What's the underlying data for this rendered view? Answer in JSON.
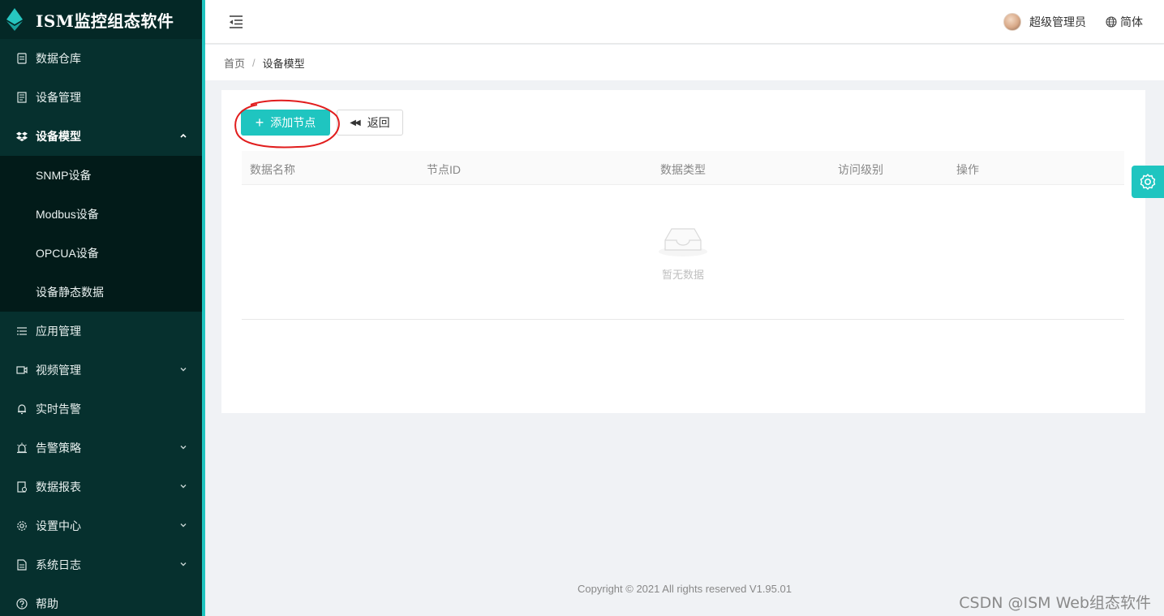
{
  "brand": {
    "title": "ISM监控组态软件",
    "accent_color": "#1fc5c0",
    "sidebar_bg": "#06302e"
  },
  "sidebar": {
    "items": [
      {
        "label": "数据仓库",
        "icon": "database-icon"
      },
      {
        "label": "设备管理",
        "icon": "device-icon"
      },
      {
        "label": "设备模型",
        "icon": "dropbox-icon",
        "expanded": true
      },
      {
        "label": "应用管理",
        "icon": "list-icon"
      },
      {
        "label": "视频管理",
        "icon": "video-icon"
      },
      {
        "label": "实时告警",
        "icon": "bell-icon"
      },
      {
        "label": "告警策略",
        "icon": "alarm-icon"
      },
      {
        "label": "数据报表",
        "icon": "report-icon"
      },
      {
        "label": "设置中心",
        "icon": "gear-icon"
      },
      {
        "label": "系统日志",
        "icon": "log-icon"
      },
      {
        "label": "帮助",
        "icon": "help-icon"
      }
    ],
    "submenu": [
      {
        "label": "SNMP设备"
      },
      {
        "label": "Modbus设备"
      },
      {
        "label": "OPCUA设备"
      },
      {
        "label": "设备静态数据"
      }
    ]
  },
  "header": {
    "user_name": "超级管理员",
    "language": "简体"
  },
  "breadcrumb": {
    "home": "首页",
    "separator": "/",
    "current": "设备模型"
  },
  "toolbar": {
    "add_label": "添加节点",
    "back_label": "返回"
  },
  "table": {
    "columns": [
      "数据名称",
      "节点ID",
      "数据类型",
      "访问级别",
      "操作"
    ],
    "rows": [],
    "empty_text": "暂无数据"
  },
  "footer": {
    "copyright": "Copyright © 2021 All rights reserved V1.95.01"
  },
  "watermark": "CSDN @ISM Web组态软件"
}
